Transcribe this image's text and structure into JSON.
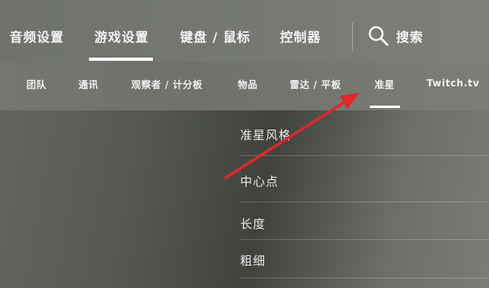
{
  "top_tabs": [
    {
      "label": "音频设置"
    },
    {
      "label": "游戏设置",
      "active": true
    },
    {
      "label": "键盘 / 鼠标"
    },
    {
      "label": "控制器"
    }
  ],
  "search": {
    "label": "搜索",
    "icon": "search-icon"
  },
  "sub_tabs": [
    {
      "label": "团队"
    },
    {
      "label": "通讯"
    },
    {
      "label": "观察者 / 计分板"
    },
    {
      "label": "物品"
    },
    {
      "label": "雷达 / 平板"
    },
    {
      "label": "准星",
      "active": true
    },
    {
      "label": "Twitch.tv"
    }
  ],
  "settings": [
    {
      "label": "准星风格"
    },
    {
      "label": "中心点"
    },
    {
      "label": "长度"
    },
    {
      "label": "粗细"
    }
  ],
  "colors": {
    "annotation_arrow": "#e02828",
    "active_underline": "#ffffff"
  }
}
